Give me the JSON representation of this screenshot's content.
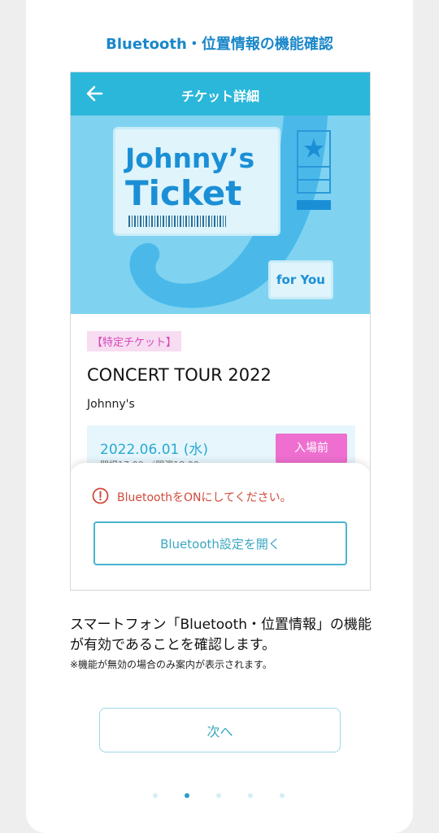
{
  "page_title": "Bluetooth・位置情報の機能確認",
  "app_bar": {
    "title": "チケット詳細",
    "back_icon": "arrow-left-icon"
  },
  "ticket_art": {
    "line1": "Johnny’s",
    "line2": "Ticket",
    "for_you": "for You"
  },
  "ticket": {
    "tag": "【特定チケット】",
    "tour": "CONCERT TOUR 2022",
    "artist": "Johnny's",
    "date": "2022.06.01 (水)",
    "time": "開場17:00 ／開演18:00",
    "status": "入場前"
  },
  "sheet": {
    "warning_icon": "exclamation-circle-icon",
    "warning": "BluetoothをONにしてください。",
    "button": "Bluetooth設定を開く"
  },
  "description": "スマートフォン「Bluetooth・位置情報」の機能が有効であることを確認します。",
  "note": "※機能が無効の場合のみ案内が表示されます。",
  "next_button": "次へ",
  "pagination": {
    "total": 5,
    "current": 2
  },
  "colors": {
    "accent": "#2bb7da",
    "title_blue": "#1a87c9",
    "badge_pink": "#ee6fcf",
    "warning_red": "#d04a3b"
  }
}
